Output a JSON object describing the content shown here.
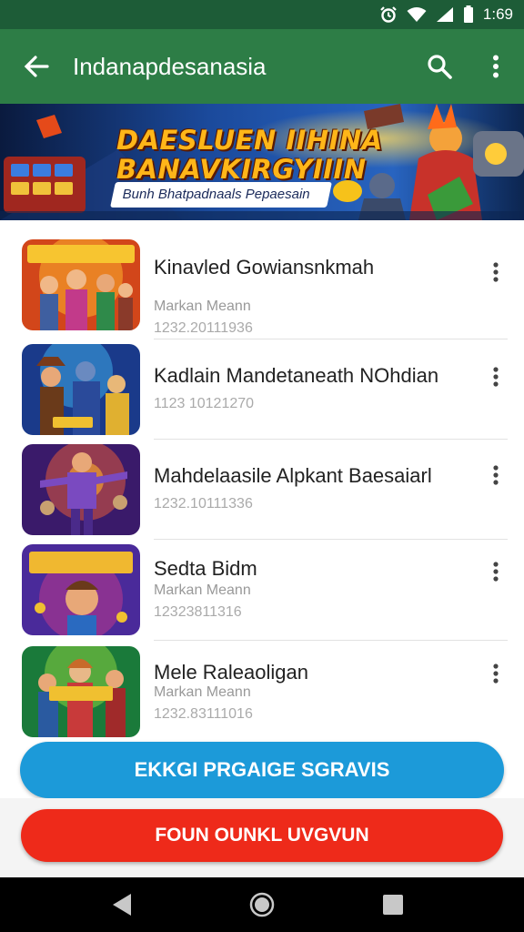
{
  "status_bar": {
    "time": "1:69",
    "icons": [
      "alarm-icon",
      "wifi-icon",
      "signal-icon",
      "battery-icon"
    ]
  },
  "app_bar": {
    "title": "Indanapdesanasia",
    "icons": [
      "back-arrow-icon",
      "search-icon",
      "more-vert-icon"
    ]
  },
  "banner": {
    "headline_line1": "DAESLUEN IIHINA",
    "headline_line2": "BANAVKIRGYIIIN",
    "tagline": "Bunh Bhatpadnaals Pepaesain"
  },
  "items": [
    {
      "title": "Kinavled Gowiansnkmah",
      "subtitle": "Markan Meann",
      "number": "1232.20111936"
    },
    {
      "title": "Kadlain Mandetaneath NOhdian",
      "subtitle": "",
      "number": "1123 10121270"
    },
    {
      "title": "Mahdelaasile Alpkant Baesaiarl",
      "subtitle": "",
      "number": "1232.10111336"
    },
    {
      "title": "Sedta Bidm",
      "subtitle": "Markan Meann",
      "number": "12323811316"
    },
    {
      "title": "Mele Raleaoligan",
      "subtitle": "Markan Meann",
      "number": "1232.83111016"
    }
  ],
  "buttons": {
    "primary": "EKKGI PRGAIGE SGRAVIS",
    "secondary": "FOUN OUNKL UVGVUN"
  },
  "colors": {
    "app_bar": "#2d7d46",
    "status_bar": "#1d5c37",
    "primary_button": "#1c9ad9",
    "secondary_button": "#ee2a1a"
  },
  "nav": [
    "back-nav-icon",
    "home-nav-icon",
    "recents-nav-icon"
  ]
}
